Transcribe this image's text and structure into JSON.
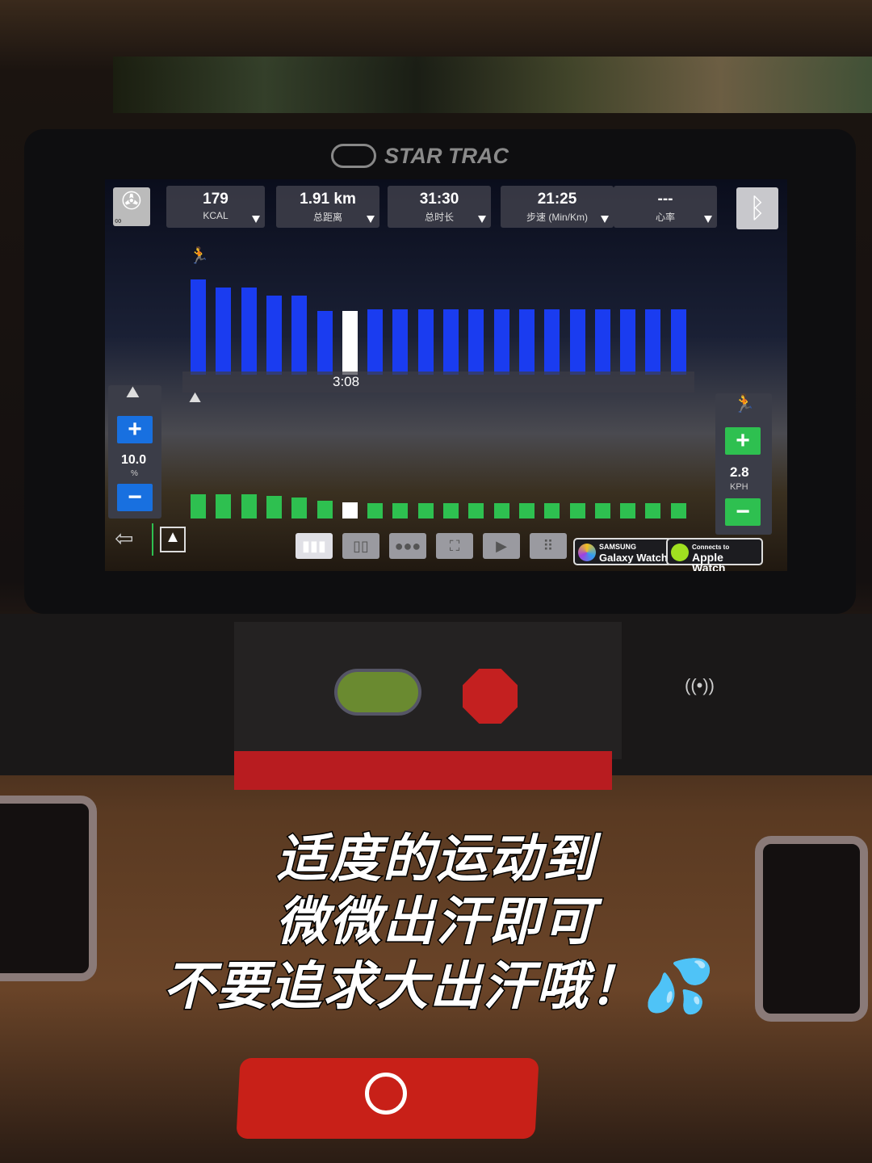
{
  "brand": "STAR TRAC",
  "stats": [
    {
      "value": "179",
      "label": "KCAL"
    },
    {
      "value": "1.91 km",
      "label": "总距离"
    },
    {
      "value": "31:30",
      "label": "总时长"
    },
    {
      "value": "21:25",
      "label": "步速 (Min/Km)"
    },
    {
      "value": "---",
      "label": "心率"
    }
  ],
  "fan": {
    "label": "∞"
  },
  "profile": {
    "current_time": "3:08",
    "current_segment": 7,
    "top_levels": [
      12,
      11,
      11,
      10,
      10,
      8,
      8,
      8.2,
      8.2,
      8.2,
      8.2,
      8.2,
      8.2,
      8.2,
      8.2,
      8.2,
      8.2,
      8.2,
      8.2,
      8.2
    ],
    "bottom_levels": [
      3,
      3,
      3,
      2.8,
      2.6,
      2.2,
      2.0,
      1.9,
      1.9,
      1.9,
      1.9,
      1.9,
      1.9,
      1.9,
      1.9,
      1.9,
      1.9,
      1.9,
      1.9,
      1.9
    ],
    "top_color": "#1a3cf0",
    "bottom_color": "#2ec050",
    "current_color": "#ffffff"
  },
  "incline": {
    "value": "10.0",
    "unit": "%"
  },
  "speed": {
    "value": "2.8",
    "unit": "KPH"
  },
  "toolbar": [
    "bar-chart",
    "split-view",
    "dots",
    "fullscreen",
    "video",
    "apps"
  ],
  "samsung": {
    "brand": "SAMSUNG",
    "name": "Galaxy Watch"
  },
  "apple": {
    "top": "Connects to",
    "name": "Apple Watch"
  },
  "caption": [
    "适度的运动到",
    "微微出汗即可",
    "不要追求大出汗哦！💦"
  ],
  "colors": {
    "accent_green": "#2ec050",
    "stop_red": "#c42020"
  }
}
